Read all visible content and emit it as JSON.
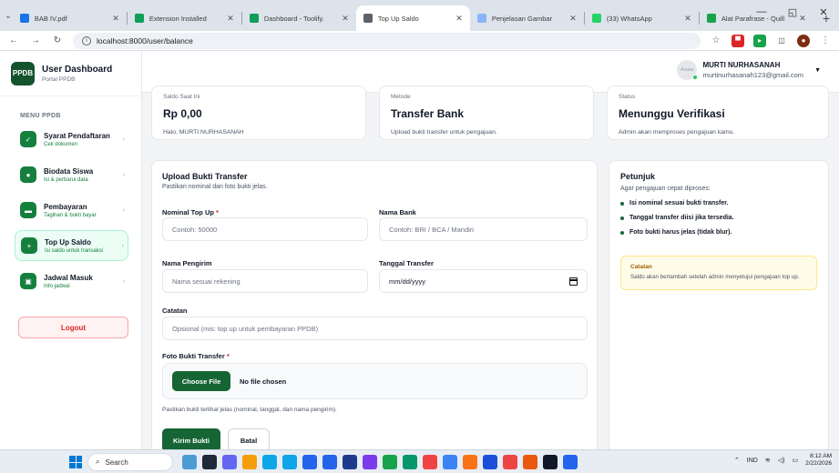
{
  "browser": {
    "tabs": [
      {
        "title": "BAB IV.pdf",
        "color": "#1a73e8",
        "active": false
      },
      {
        "title": "Extension Installed",
        "color": "#0f9d58",
        "active": false
      },
      {
        "title": "Dashboard - Toolify.",
        "color": "#0f9d58",
        "active": false
      },
      {
        "title": "Top Up Saldo",
        "color": "#5f6368",
        "active": true
      },
      {
        "title": "Penjelasan Gambar",
        "color": "#8ab4f8",
        "active": false
      },
      {
        "title": "(33) WhatsApp",
        "color": "#25d366",
        "active": false
      },
      {
        "title": "Alat Parafrase - Quill",
        "color": "#16a34a",
        "active": false
      }
    ],
    "url": "localhost:8000/user/balance",
    "new_tab": "+",
    "win_minimize": "—",
    "win_restore": "◱",
    "win_close": "✕"
  },
  "sidebar": {
    "logo": "PPDB",
    "title": "User Dashboard",
    "subtitle": "Portal PPDB",
    "menu_heading": "MENU PPDB",
    "items": [
      {
        "label": "Syarat Pendaftaran",
        "sub": "Cek dokumen",
        "icon": "check-icon",
        "glyph": "✓",
        "active": false
      },
      {
        "label": "Biodata Siswa",
        "sub": "Isi & perbarui data",
        "icon": "user-icon",
        "glyph": "●",
        "active": false
      },
      {
        "label": "Pembayaran",
        "sub": "Tagihan & bukti bayar",
        "icon": "wallet-icon",
        "glyph": "▬",
        "active": false
      },
      {
        "label": "Top Up Saldo",
        "sub": "Isi saldo untuk transaksi",
        "icon": "plus-icon",
        "glyph": "+",
        "active": true
      },
      {
        "label": "Jadwal Masuk",
        "sub": "Info jadwal",
        "icon": "calendar-icon",
        "glyph": "▣",
        "active": false
      }
    ],
    "logout": "Logout"
  },
  "header": {
    "avatar_text": "Avatar",
    "user_name": "MURTI NURHASANAH",
    "user_email": "murtinurhasanah123@gmail.com"
  },
  "stats": [
    {
      "label": "Saldo Saat Ini",
      "value": "Rp 0,00",
      "note": "Halo, MURTI NURHASANAH"
    },
    {
      "label": "Metode",
      "value": "Transfer Bank",
      "note": "Upload bukti transfer untuk pengajuan."
    },
    {
      "label": "Status",
      "value": "Menunggu Verifikasi",
      "note": "Admin akan memproses pengajuan kamu."
    }
  ],
  "form": {
    "title": "Upload Bukti Transfer",
    "subtitle": "Pastikan nominal dan foto bukti jelas.",
    "nominal_label": "Nominal Top Up",
    "nominal_placeholder": "Contoh: 50000",
    "bank_label": "Nama Bank",
    "bank_placeholder": "Contoh: BRI / BCA / Mandiri",
    "sender_label": "Nama Pengirim",
    "sender_placeholder": "Nama sesuai rekening",
    "date_label": "Tanggal Transfer",
    "date_value": "mm/dd/yyyy",
    "note_label": "Catatan",
    "note_placeholder": "Opsional (mis: top up untuk pembayaran PPDB)",
    "file_label": "Foto Bukti Transfer",
    "choose_file": "Choose File",
    "file_status": "No file chosen",
    "file_hint": "Pastikan bukti terlihat jelas (nominal, tanggal, dan nama pengirim).",
    "submit": "Kirim Bukti",
    "cancel": "Batal",
    "required_mark": "*"
  },
  "guide": {
    "title": "Petunjuk",
    "subtitle": "Agar pengajuan cepat diproses:",
    "tips": [
      "Isi nominal sesuai bukti transfer.",
      "Tanggal transfer diisi jika tersedia.",
      "Foto bukti harus jelas (tidak blur)."
    ],
    "note_title": "Catatan",
    "note_body": "Saldo akan bertambah setelah admin menyetujui pengajuan top up."
  },
  "taskbar": {
    "search": "Search",
    "lang": "IND",
    "time": "8:12 AM",
    "date": "2/22/2026"
  }
}
